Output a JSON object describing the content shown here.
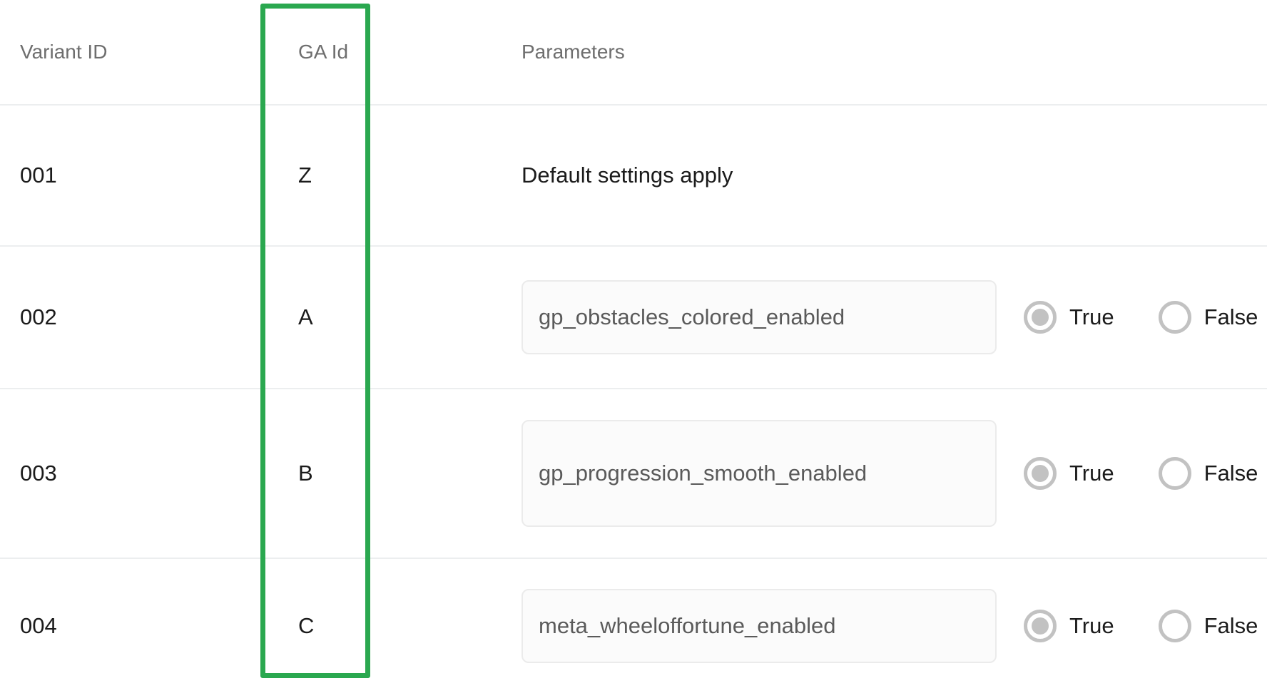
{
  "table": {
    "columns": [
      {
        "key": "variant_id",
        "label": "Variant ID"
      },
      {
        "key": "ga_id",
        "label": "GA Id"
      },
      {
        "key": "parameters",
        "label": "Parameters"
      }
    ],
    "rows": [
      {
        "variant_id": "001",
        "ga_id": "Z",
        "parameter_kind": "text",
        "parameter_text": "Default settings apply",
        "has_toggle": false
      },
      {
        "variant_id": "002",
        "ga_id": "A",
        "parameter_kind": "input",
        "parameter_text": "gp_obstacles_colored_enabled",
        "has_toggle": true,
        "true_label": "True",
        "false_label": "False",
        "selected": "True"
      },
      {
        "variant_id": "003",
        "ga_id": "B",
        "parameter_kind": "input",
        "parameter_text": "gp_progression_smooth_enabled",
        "has_toggle": true,
        "true_label": "True",
        "false_label": "False",
        "selected": "True"
      },
      {
        "variant_id": "004",
        "ga_id": "C",
        "parameter_kind": "input",
        "parameter_text": "meta_wheeloffortune_enabled",
        "has_toggle": true,
        "true_label": "True",
        "false_label": "False",
        "selected": "True"
      }
    ]
  },
  "annotation": {
    "kind": "highlight-rectangle",
    "target_column": "GA Id",
    "color": "#2aa84f"
  },
  "colors": {
    "highlight_green": "#2aa84f",
    "header_text": "#6e6e6e",
    "body_text": "#1b1b1b",
    "input_text": "#5a5a5a",
    "input_background": "#fbfbfb",
    "input_border": "#ebebeb",
    "row_divider": "#eceeef",
    "radio_gray": "#c2c2c2",
    "page_background": "#ffffff"
  }
}
